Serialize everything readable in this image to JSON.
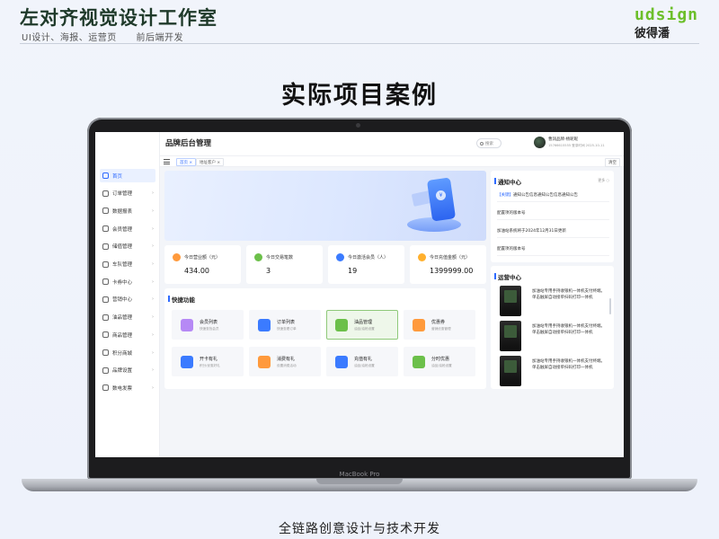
{
  "page": {
    "studio_title": "左对齐视觉设计工作室",
    "studio_subtitle_a": "UI设计、海报、运营页",
    "studio_subtitle_b": "前后端开发",
    "logo_top": "udsign",
    "logo_bottom": "彼得潘",
    "main_heading": "实际项目案例",
    "footer_caption": "全链路创意设计与技术开发",
    "laptop_label": "MacBook Pro"
  },
  "app": {
    "title": "品牌后台管理",
    "search_placeholder": "搜索",
    "user": {
      "name": "曹润品牌-杨昵昵",
      "meta": "15766615555 登录时间 2025-10-11"
    },
    "tabs": [
      {
        "label": "首页 ×"
      },
      {
        "label": "地址客户 ×"
      }
    ],
    "clear_label": "清空",
    "sidebar": [
      {
        "label": "首页"
      },
      {
        "label": "订单管理"
      },
      {
        "label": "数据报表"
      },
      {
        "label": "会员管理"
      },
      {
        "label": "储值管理"
      },
      {
        "label": "车队管理"
      },
      {
        "label": "卡券中心"
      },
      {
        "label": "营销中心"
      },
      {
        "label": "油品管理"
      },
      {
        "label": "商品管理"
      },
      {
        "label": "积分商城"
      },
      {
        "label": "品牌设置"
      },
      {
        "label": "数电发票"
      }
    ],
    "stats": [
      {
        "label": "今日营业额（元）",
        "value": "434.00",
        "color": "#ff9a3c"
      },
      {
        "label": "今日交易笔数",
        "value": "3",
        "color": "#6cc04a"
      },
      {
        "label": "今日激活会员（人）",
        "value": "19",
        "color": "#3b7bff"
      },
      {
        "label": "今日充值金额（元）",
        "value": "1399999.00",
        "color": "#ffb02e"
      }
    ],
    "quick": {
      "title": "快捷功能",
      "items": [
        {
          "name": "会员列表",
          "desc": "快速查找会员",
          "color": "#b689f5"
        },
        {
          "name": "订单列表",
          "desc": "快速查看订单",
          "color": "#3b7bff"
        },
        {
          "name": "油品管理",
          "desc": "油品/油枪设置",
          "color": "#6cc04a"
        },
        {
          "name": "优惠券",
          "desc": "营销优惠管理",
          "color": "#ff9a3c"
        },
        {
          "name": "开卡有礼",
          "desc": "积分/优惠好礼",
          "color": "#3b7bff"
        },
        {
          "name": "消费有礼",
          "desc": "设置消费活动",
          "color": "#ff9a3c"
        },
        {
          "name": "充值有礼",
          "desc": "油品/油枪设置",
          "color": "#3b7bff"
        },
        {
          "name": "分时优惠",
          "desc": "油品/油枪设置",
          "color": "#6cc04a"
        }
      ]
    },
    "notice": {
      "title": "通知中心",
      "more": "更多 ○",
      "items": [
        {
          "tag": "【关键】",
          "text": "通知公告信息通知公告信息通知公告"
        },
        {
          "tag": "",
          "text": "配置项的版本号"
        },
        {
          "tag": "",
          "text": "加油站系统将于2024年12月31日更新"
        },
        {
          "tag": "",
          "text": "配置项的版本号"
        }
      ]
    },
    "ops": {
      "title": "运营中心",
      "items": [
        {
          "text": "加油站专用手持收银机一体机支付终端。单击触屏自动接单扫码打印一体机"
        },
        {
          "text": "加油站专用手持收银机一体机支付终端。单击触屏自动接单扫码打印一体机"
        },
        {
          "text": "加油站专用手持收银机一体机支付终端。单击触屏自动接单扫码打印一体机"
        }
      ]
    }
  }
}
